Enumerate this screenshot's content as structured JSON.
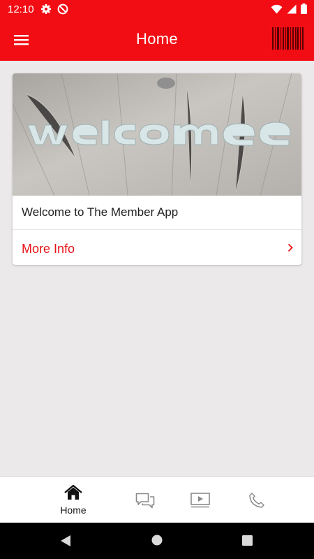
{
  "status_bar": {
    "time": "12:10",
    "icons": [
      "gear-icon",
      "no-disturb-icon",
      "wifi-icon",
      "signal-icon",
      "battery-icon"
    ]
  },
  "app_bar": {
    "title": "Home",
    "left_icon": "menu-icon",
    "right_icon": "barcode-icon",
    "color": "#f20d14"
  },
  "card": {
    "image_text": "welcome",
    "title": "Welcome to The Member App",
    "action_label": "More Info",
    "action_icon": "chevron-right-icon",
    "accent": "#e81319"
  },
  "bottom_nav": {
    "items": [
      {
        "icon": "home-icon",
        "label": "Home",
        "active": true
      },
      {
        "icon": "chat-icon",
        "label": ""
      },
      {
        "icon": "video-icon",
        "label": ""
      },
      {
        "icon": "phone-icon",
        "label": ""
      }
    ]
  },
  "system_nav": {
    "icons": [
      "back-icon",
      "home-circle-icon",
      "recents-icon"
    ]
  }
}
